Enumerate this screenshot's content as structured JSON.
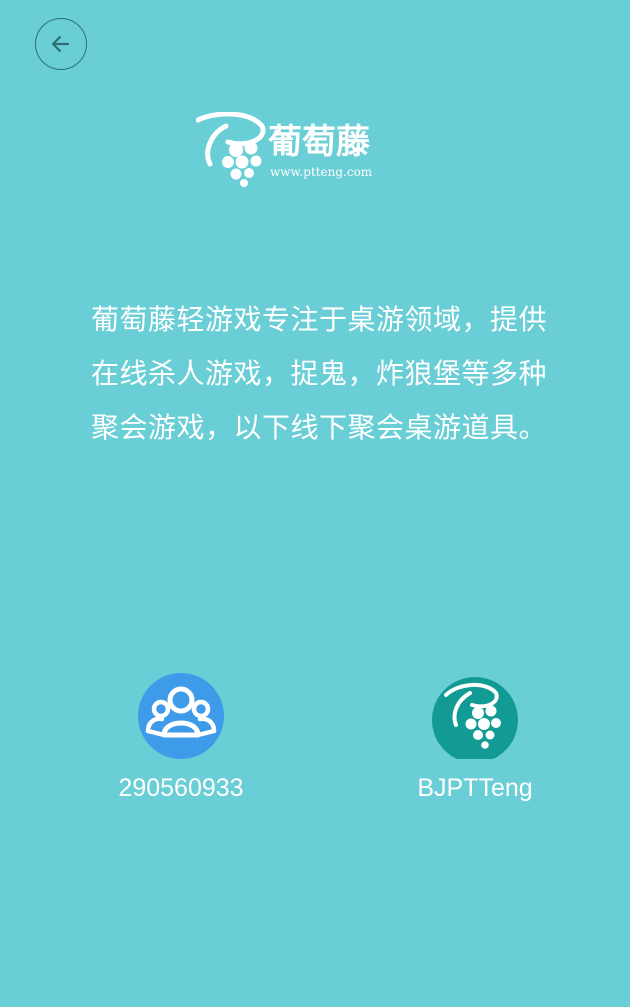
{
  "header": {
    "back_icon": "arrow-left-icon"
  },
  "logo": {
    "title": "葡萄藤",
    "url": "www.ptteng.com",
    "icon": "grape-logo-icon"
  },
  "intro": {
    "text": "葡萄藤轻游戏专注于桌游领域，提供在线杀人游戏，捉鬼，炸狼堡等多种聚会游戏，以下线下聚会桌游道具。"
  },
  "contacts": [
    {
      "label": "290560933",
      "icon": "qq-group-icon",
      "color": "#3d9be9"
    },
    {
      "label": "BJPTTeng",
      "icon": "grape-logo-icon",
      "color": "#129b95"
    }
  ],
  "colors": {
    "background": "#69ced5",
    "text": "#ffffff",
    "back_border": "#2f6f73"
  }
}
